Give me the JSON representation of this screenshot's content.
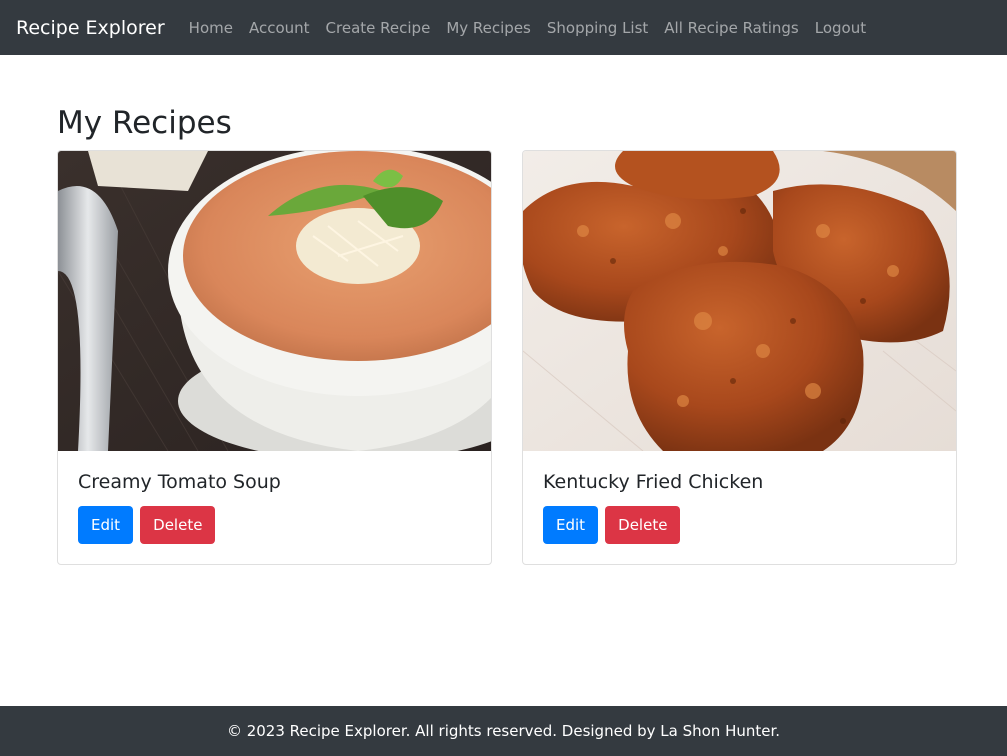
{
  "navbar": {
    "brand": "Recipe Explorer",
    "links": [
      "Home",
      "Account",
      "Create Recipe",
      "My Recipes",
      "Shopping List",
      "All Recipe Ratings",
      "Logout"
    ]
  },
  "page": {
    "title": "My Recipes"
  },
  "recipes": [
    {
      "title": "Creamy Tomato Soup",
      "edit_label": "Edit",
      "delete_label": "Delete",
      "image": "tomato-soup-photo"
    },
    {
      "title": "Kentucky Fried Chicken",
      "edit_label": "Edit",
      "delete_label": "Delete",
      "image": "fried-chicken-photo"
    }
  ],
  "footer": {
    "text": "© 2023 Recipe Explorer. All rights reserved. Designed by La Shon Hunter."
  },
  "colors": {
    "navbar_bg": "#343a40",
    "primary": "#007bff",
    "danger": "#dc3545"
  }
}
